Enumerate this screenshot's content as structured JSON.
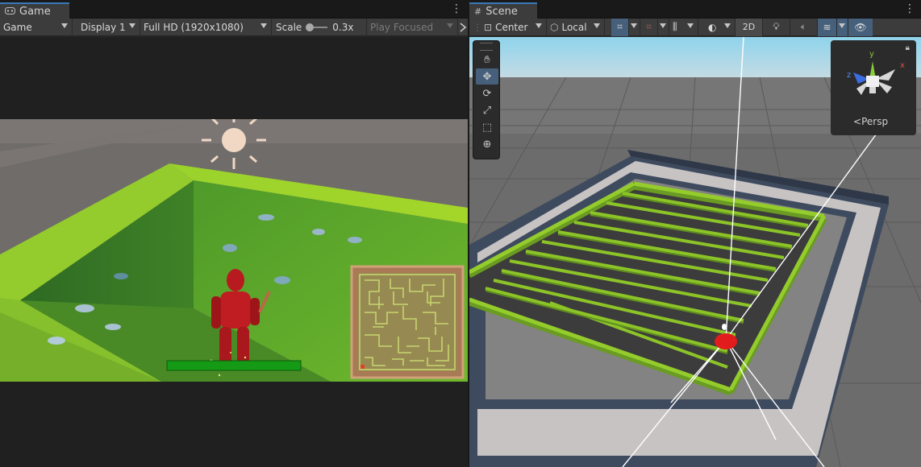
{
  "game": {
    "tab_label": "Game",
    "tab_icon": "gamepad-icon",
    "toolbar": {
      "view_mode": "Game",
      "display": "Display 1",
      "resolution": "Full HD (1920x1080)",
      "scale_label": "Scale",
      "scale_value": "0.3x",
      "play_mode": "Play Focused"
    }
  },
  "scene": {
    "tab_label": "Scene",
    "tab_icon": "grid-icon",
    "toolbar": {
      "pivot_mode": "Center",
      "pivot_rotation": "Local",
      "mode_2d": "2D"
    },
    "tools": [
      "hand-tool",
      "move-tool",
      "rotate-tool",
      "scale-tool",
      "rect-tool",
      "transform-tool"
    ],
    "gizmo": {
      "projection_label": "Persp",
      "axes": [
        "y",
        "x",
        "z"
      ]
    }
  },
  "colors": {
    "accent": "#3a79bb",
    "maze_green": "#8ccc2c",
    "player_red": "#c8191e",
    "health_green": "#18a018"
  }
}
